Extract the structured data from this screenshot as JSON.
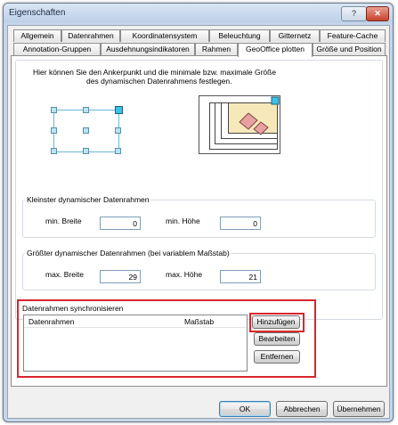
{
  "window": {
    "title": "Eigenschaften",
    "help_label": "?",
    "close_label": "✕"
  },
  "tabs_row1": [
    "Allgemein",
    "Datenrahmen",
    "Koordinatensystem",
    "Beleuchtung",
    "Gitternetz",
    "Feature-Cache"
  ],
  "tabs_row2": [
    "Annotation-Gruppen",
    "Ausdehnungsindikatoren",
    "Rahmen",
    "GeoOffice plotten",
    "Größe und Position"
  ],
  "active_tab": "GeoOffice plotten",
  "description": {
    "line1": "Hier können Sie den Ankerpunkt und die minimale bzw. maximale Größe",
    "line2": "des dynamischen Datenrahmens festlegen."
  },
  "min_group": {
    "title": "Kleinster dynamischer Datenrahmen",
    "width_label": "min. Breite",
    "width_value": "0",
    "height_label": "min. Höhe",
    "height_value": "0"
  },
  "max_group": {
    "title": "Größter dynamischer Datenrahmen (bei variablem Maßstab)",
    "width_label": "max. Breite",
    "width_value": "29",
    "height_label": "max. Höhe",
    "height_value": "21"
  },
  "sync_group": {
    "title": "Datenrahmen synchronisieren",
    "col_datenrahmen": "Datenrahmen",
    "col_massstab": "Maßstab",
    "add_label": "Hinzufügen",
    "edit_label": "Bearbeiten",
    "remove_label": "Entfernen"
  },
  "footer": {
    "ok_label": "OK",
    "cancel_label": "Abbrechen",
    "apply_label": "Übernehmen"
  },
  "colors": {
    "highlight": "#d9262c",
    "anchor": "#b9e4f2",
    "window_frame": "#c6d6ea"
  },
  "icons": [
    "anchor-grid-icon",
    "frame-preview-icon"
  ]
}
